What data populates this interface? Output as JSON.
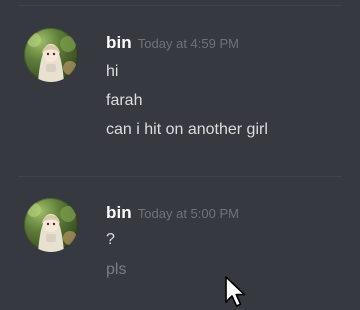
{
  "messages": [
    {
      "author": "bin",
      "timestamp": "Today at 4:59 PM",
      "lines": [
        "hi",
        "farah",
        "can i hit on another girl"
      ]
    },
    {
      "author": "bin",
      "timestamp": "Today at 5:00 PM",
      "lines": [
        "?",
        "pls"
      ]
    }
  ],
  "colors": {
    "background": "#36393f",
    "username": "#ffffff",
    "timestamp": "#6f7378",
    "message_text": "#dcddde",
    "pending_text": "#7a7d82"
  },
  "icons": {
    "cursor": "mouse-pointer-icon",
    "avatar": "user-avatar"
  }
}
